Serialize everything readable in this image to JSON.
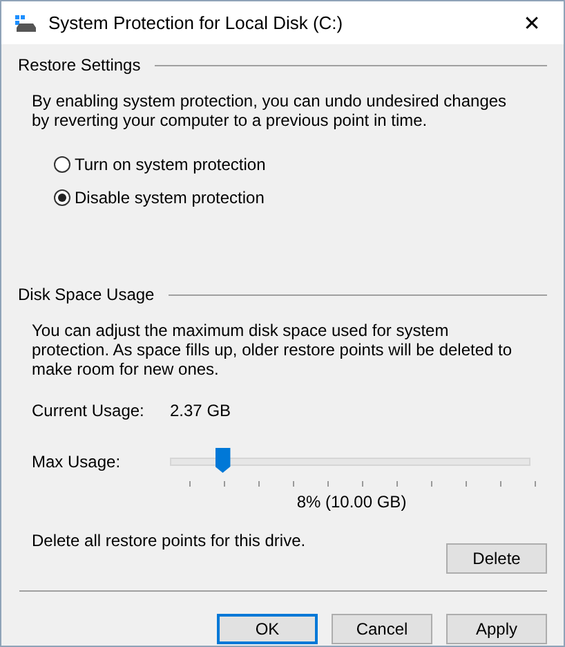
{
  "window": {
    "title": "System Protection for Local Disk (C:)",
    "close": "✕"
  },
  "restore_settings": {
    "heading": "Restore Settings",
    "description": "By enabling system protection, you can undo undesired changes by reverting your computer to a previous point in time.",
    "options": [
      {
        "label": "Turn on system protection",
        "selected": false
      },
      {
        "label": "Disable system protection",
        "selected": true
      }
    ]
  },
  "disk_space_usage": {
    "heading": "Disk Space Usage",
    "description": "You can adjust the maximum disk space used for system protection. As space fills up, older restore points will be deleted to make room for new ones.",
    "current_usage_label": "Current Usage:",
    "current_usage_value": "2.37 GB",
    "max_usage_label": "Max Usage:",
    "max_usage": {
      "level": 0.08,
      "reading": "8% (10.00 GB)"
    },
    "delete_text": "Delete all restore points for this drive.",
    "delete_button": "Delete"
  },
  "buttons": [
    {
      "label": "OK",
      "default": true
    },
    {
      "label": "Cancel",
      "default": false
    },
    {
      "label": "Apply",
      "default": false
    }
  ]
}
